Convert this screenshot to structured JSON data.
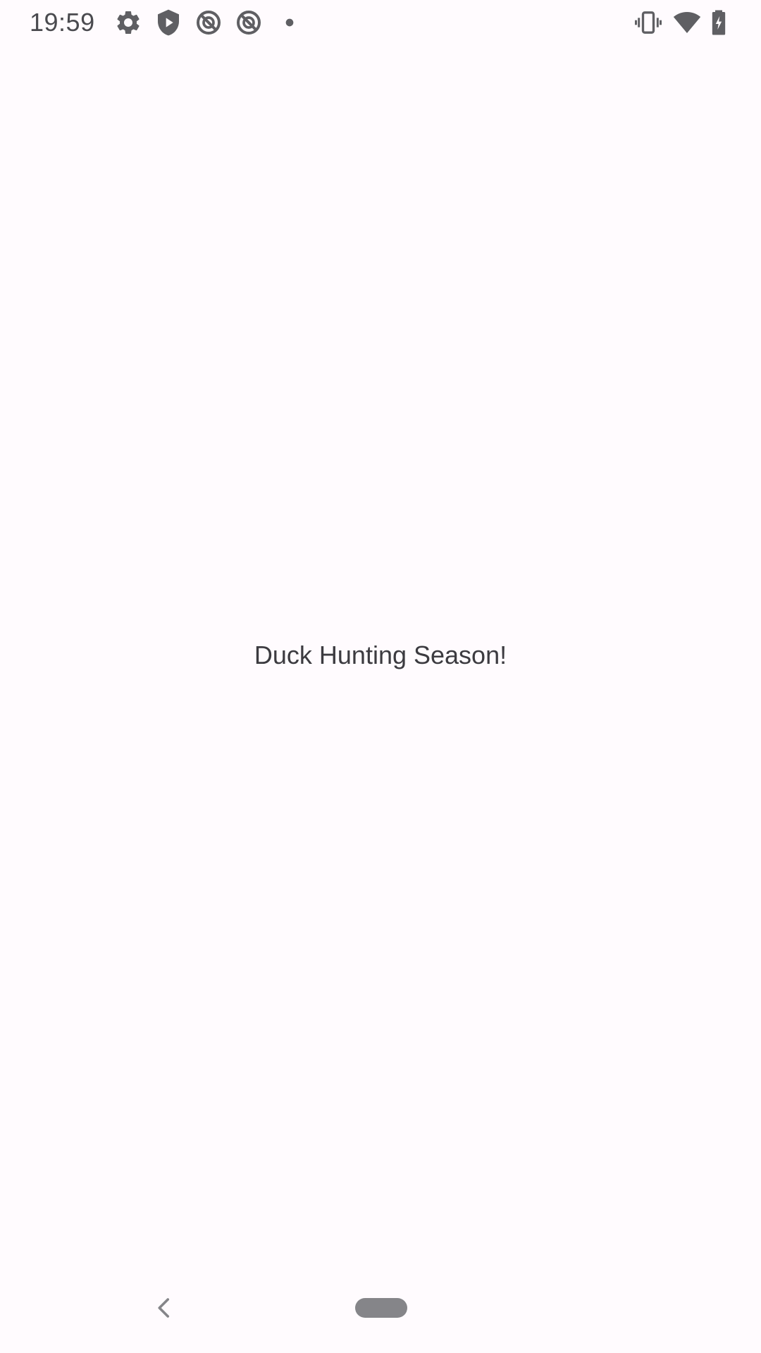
{
  "status_bar": {
    "time": "19:59",
    "left_icons": [
      "settings-icon",
      "play-protect-icon",
      "no-data-saver-icon",
      "no-data-saver-icon",
      "notification-dot-icon"
    ],
    "right_icons": [
      "vibrate-icon",
      "wifi-icon",
      "battery-charging-icon"
    ],
    "icon_color": "#5f5f63"
  },
  "main": {
    "message": "Duck Hunting Season!"
  },
  "nav_bar": {
    "buttons": [
      "back-icon",
      "home-pill"
    ]
  },
  "colors": {
    "background": "#FFFBFE",
    "text": "#3c3b40",
    "nav_pill": "#858589"
  }
}
